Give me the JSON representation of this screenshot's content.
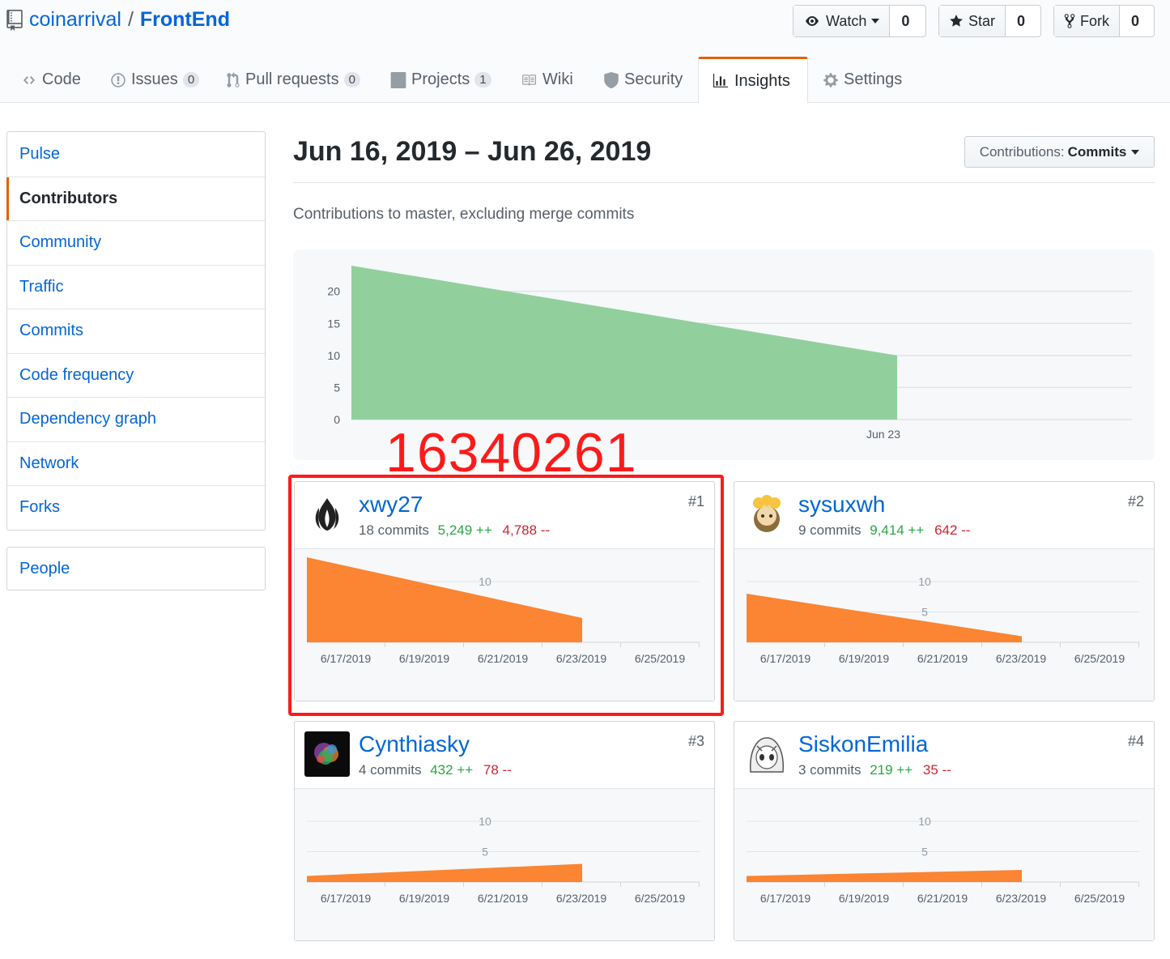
{
  "repo": {
    "owner": "coinarrival",
    "separator": "/",
    "name": "FrontEnd"
  },
  "actions": {
    "watch": {
      "label": "Watch",
      "count": "0"
    },
    "star": {
      "label": "Star",
      "count": "0"
    },
    "fork": {
      "label": "Fork",
      "count": "0"
    }
  },
  "tabs": [
    {
      "label": "Code"
    },
    {
      "label": "Issues",
      "badge": "0"
    },
    {
      "label": "Pull requests",
      "badge": "0"
    },
    {
      "label": "Projects",
      "badge": "1"
    },
    {
      "label": "Wiki"
    },
    {
      "label": "Security"
    },
    {
      "label": "Insights"
    },
    {
      "label": "Settings"
    }
  ],
  "sidebar": {
    "items": [
      {
        "label": "Pulse"
      },
      {
        "label": "Contributors",
        "active": true
      },
      {
        "label": "Community"
      },
      {
        "label": "Traffic"
      },
      {
        "label": "Commits"
      },
      {
        "label": "Code frequency"
      },
      {
        "label": "Dependency graph"
      },
      {
        "label": "Network"
      },
      {
        "label": "Forks"
      }
    ],
    "people": "People"
  },
  "main": {
    "date_range": "Jun 16, 2019 – Jun 26, 2019",
    "contrib_label": "Contributions:",
    "contrib_value": "Commits",
    "subtitle": "Contributions to master, excluding merge commits"
  },
  "overlay_text": "16340261",
  "colors": {
    "accent": "#e36209",
    "link": "#0366d6",
    "area_green": "#91d09c",
    "area_orange": "#fb8532",
    "highlight": "#ff1a1a"
  },
  "chart_data": [
    {
      "type": "area",
      "yticks": [
        0,
        5,
        10,
        15,
        20
      ],
      "ylim": [
        0,
        24
      ],
      "x_tick_labels": [
        "Jun 23"
      ],
      "series": [
        {
          "values_start_end": [
            24,
            10
          ]
        }
      ]
    },
    {
      "type": "area",
      "user": "xwy27",
      "x_tick_labels": [
        "6/17/2019",
        "6/19/2019",
        "6/21/2019",
        "6/23/2019",
        "6/25/2019"
      ],
      "y_tick_labels": [
        "10"
      ],
      "ylim": [
        0,
        14
      ],
      "values_start_end": [
        14,
        4
      ]
    },
    {
      "type": "area",
      "user": "sysuxwh",
      "x_tick_labels": [
        "6/17/2019",
        "6/19/2019",
        "6/21/2019",
        "6/23/2019",
        "6/25/2019"
      ],
      "y_tick_labels": [
        "10",
        "5"
      ],
      "ylim": [
        0,
        14
      ],
      "values_start_end": [
        8,
        1
      ]
    },
    {
      "type": "area",
      "user": "Cynthiasky",
      "x_tick_labels": [
        "6/17/2019",
        "6/19/2019",
        "6/21/2019",
        "6/23/2019",
        "6/25/2019"
      ],
      "y_tick_labels": [
        "10",
        "5"
      ],
      "ylim": [
        0,
        14
      ],
      "values_start_end": [
        1,
        3
      ]
    },
    {
      "type": "area",
      "user": "SiskonEmilia",
      "x_tick_labels": [
        "6/17/2019",
        "6/19/2019",
        "6/21/2019",
        "6/23/2019",
        "6/25/2019"
      ],
      "y_tick_labels": [
        "10",
        "5"
      ],
      "ylim": [
        0,
        14
      ],
      "values_start_end": [
        1,
        2
      ]
    }
  ],
  "contributors": [
    {
      "username": "xwy27",
      "commits": "18 commits",
      "additions": "5,249 ++",
      "deletions": "4,788 --",
      "rank": "#1"
    },
    {
      "username": "sysuxwh",
      "commits": "9 commits",
      "additions": "9,414 ++",
      "deletions": "642 --",
      "rank": "#2"
    },
    {
      "username": "Cynthiasky",
      "commits": "4 commits",
      "additions": "432 ++",
      "deletions": "78 --",
      "rank": "#3"
    },
    {
      "username": "SiskonEmilia",
      "commits": "3 commits",
      "additions": "219 ++",
      "deletions": "35 --",
      "rank": "#4"
    }
  ]
}
